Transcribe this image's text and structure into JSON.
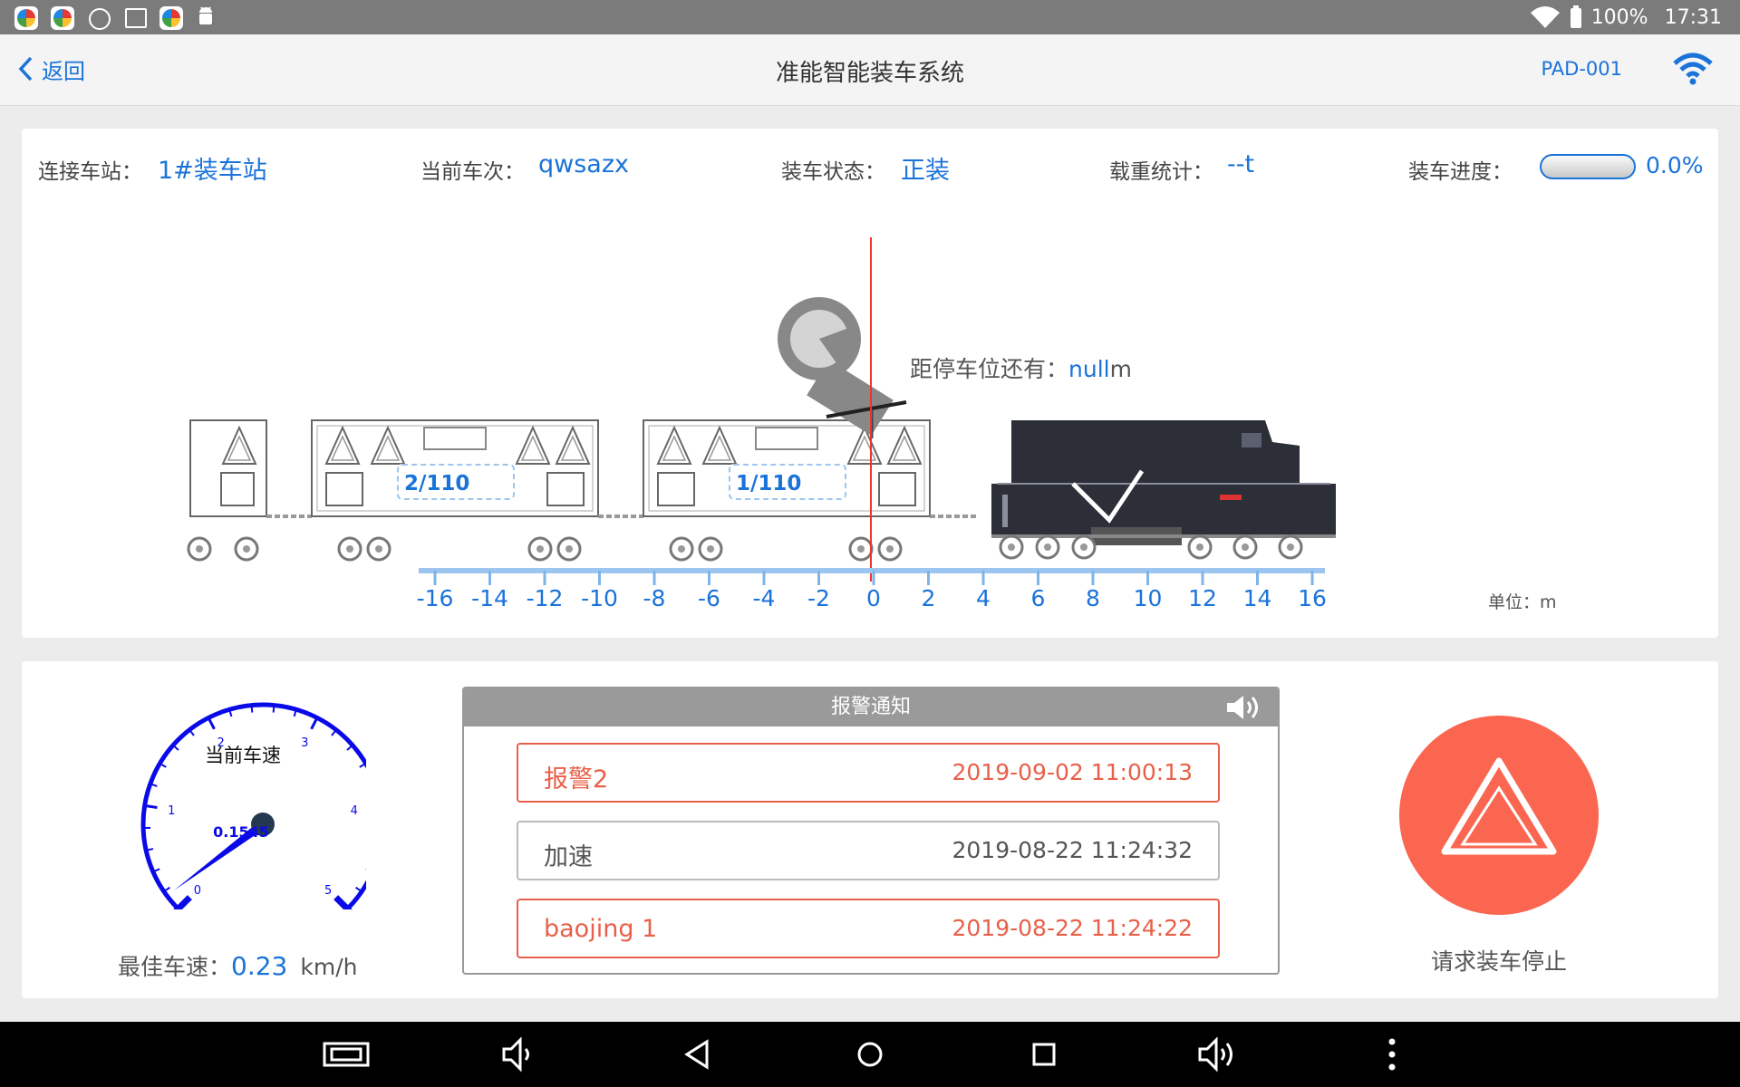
{
  "status_bar": {
    "battery": "100%",
    "time": "17:31"
  },
  "header": {
    "back_label": "返回",
    "title": "准能智能装车系统",
    "device_id": "PAD-001"
  },
  "info": {
    "station_label": "连接车站：",
    "station_value": "1#装车站",
    "train_label": "当前车次：",
    "train_value": "qwsazx",
    "status_label": "装车状态：",
    "status_value": "正装",
    "weight_label": "载重统计：",
    "weight_value": "--t",
    "progress_label": "装车进度：",
    "progress_value": "0.0%",
    "progress_fraction": 0.0
  },
  "scene": {
    "distance_label": "距停车位还有：",
    "distance_value": "null",
    "distance_unit": "m",
    "wagons": [
      {
        "label": "2/110"
      },
      {
        "label": "1/110"
      }
    ],
    "ruler_ticks": [
      "-16",
      "-14",
      "-12",
      "-10",
      "-8",
      "-6",
      "-4",
      "-2",
      "0",
      "2",
      "4",
      "6",
      "8",
      "10",
      "12",
      "14",
      "16"
    ],
    "unit_label": "单位：m"
  },
  "speedometer": {
    "title": "当前车速",
    "value": "0.1545",
    "value_number": 0.1545,
    "scale_labels": [
      "0",
      "1",
      "2",
      "3",
      "4",
      "5"
    ],
    "max": 5,
    "best_label": "最佳车速：",
    "best_value": "0.23",
    "best_unit": "km/h",
    "color": "#0a0ae8"
  },
  "alarm": {
    "title": "报警通知",
    "items": [
      {
        "name": "报警2",
        "time": "2019-09-02 11:00:13",
        "level": "alarm"
      },
      {
        "name": "加速",
        "time": "2019-08-22 11:24:32",
        "level": "normal"
      },
      {
        "name": "baojing 1",
        "time": "2019-08-22 11:24:22",
        "level": "alarm"
      }
    ]
  },
  "stop": {
    "label": "请求装车停止",
    "color": "#fb6650"
  },
  "colors": {
    "accent": "#1a73d9",
    "alarm": "#e8604a"
  }
}
